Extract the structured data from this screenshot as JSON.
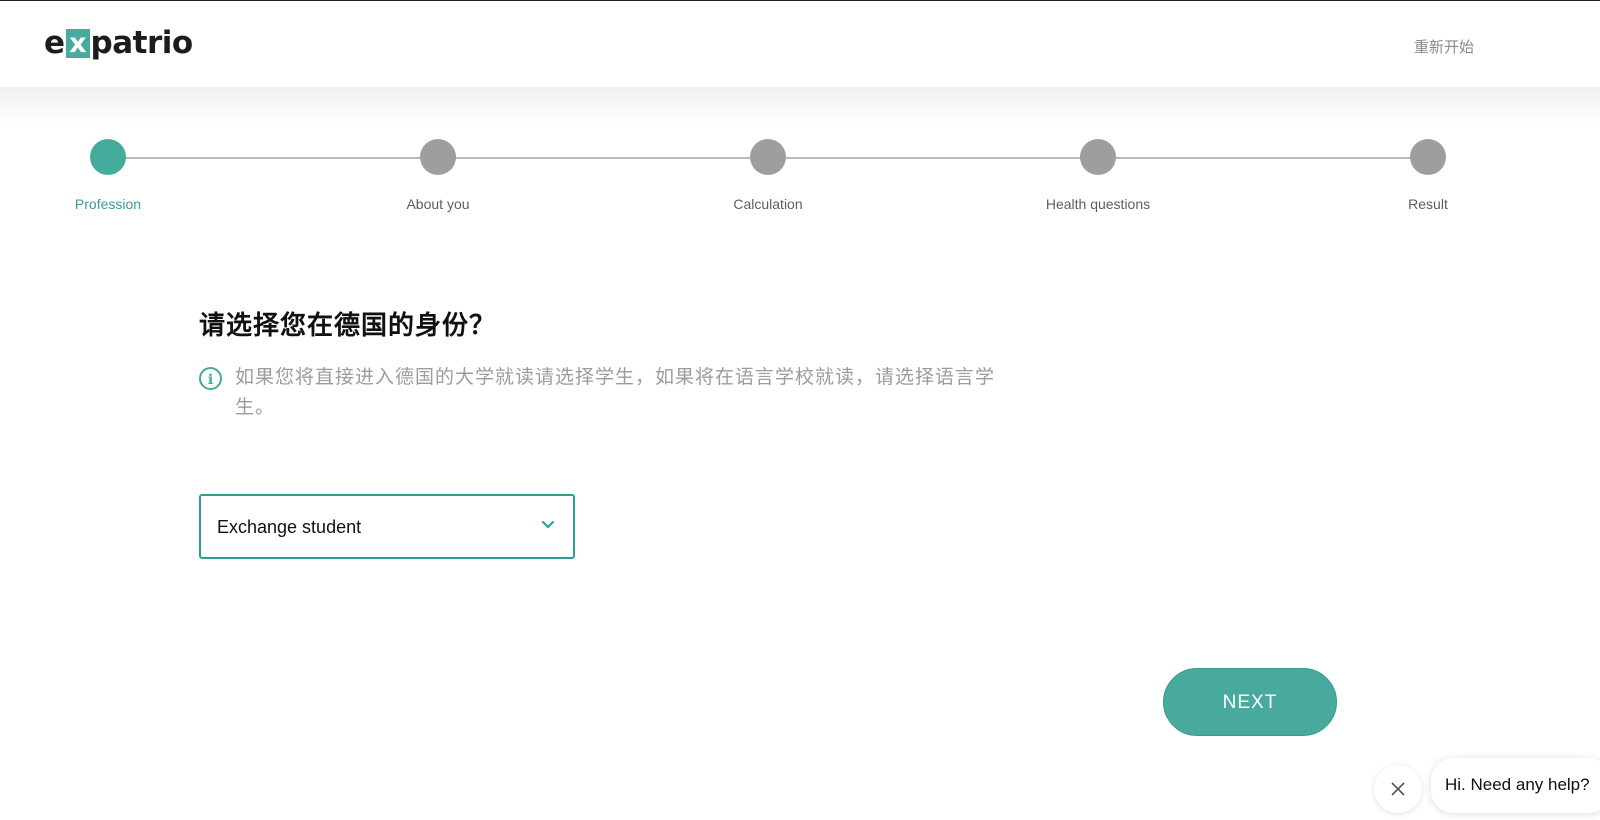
{
  "header": {
    "logo_parts": [
      "e",
      "x",
      "patrio"
    ],
    "restart_label": "重新开始"
  },
  "stepper": {
    "steps": [
      {
        "label": "Profession",
        "state": "active"
      },
      {
        "label": "About you",
        "state": "pending"
      },
      {
        "label": "Calculation",
        "state": "pending"
      },
      {
        "label": "Health questions",
        "state": "pending"
      },
      {
        "label": "Result",
        "state": "pending"
      }
    ]
  },
  "main": {
    "question": "请选择您在德国的身份？",
    "hint_icon": "info-icon",
    "hint": "如果您将直接进入德国的大学就读请选择学生，如果将在语言学校就读，请选择语言学生。",
    "select": {
      "value": "Exchange student",
      "icon": "chevron-down-icon"
    },
    "next_label": "NEXT"
  },
  "chat": {
    "close_icon": "close-icon",
    "bubble_text": "Hi. Need any help?"
  },
  "colors": {
    "accent": "#45ab9c",
    "step_inactive": "#9e9e9e",
    "hint_text": "#9c9c9c"
  }
}
